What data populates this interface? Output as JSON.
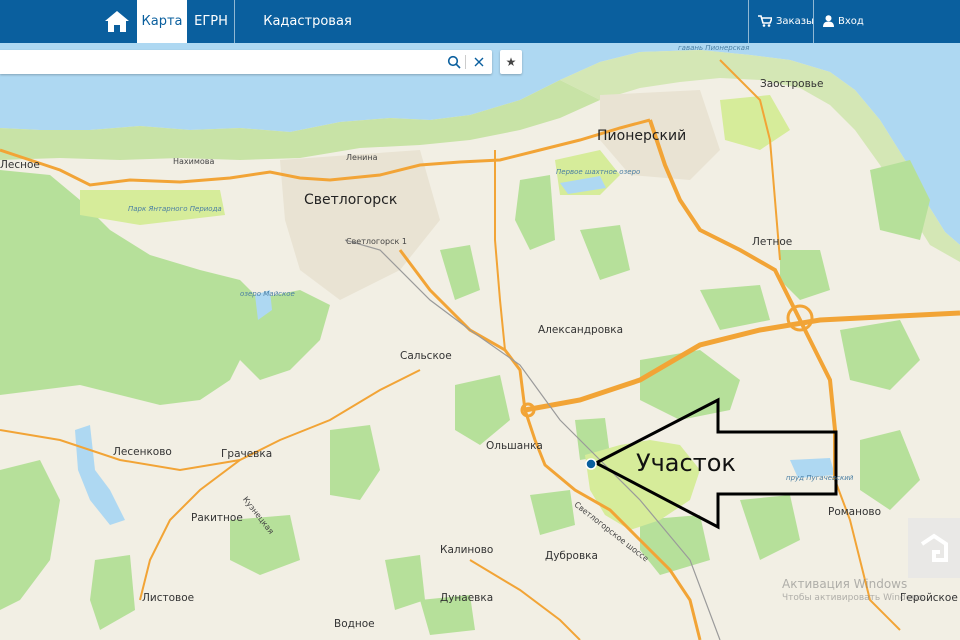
{
  "nav": {
    "tabs": [
      {
        "label": "Карта",
        "active": true
      },
      {
        "label": "ЕГРН",
        "active": false
      },
      {
        "label": "Кадастровая стоимость",
        "active": false
      }
    ],
    "orders_label": "Заказы",
    "login_label": "Вход"
  },
  "search": {
    "value": "",
    "placeholder": ""
  },
  "colors": {
    "header": "#0a5f9e",
    "water": "#aed8f2",
    "land": "#f2efe4",
    "forest": "#b6e09a",
    "road": "#f2a436",
    "marker": "#0a5f9e"
  },
  "icons": [
    "home-icon",
    "search-icon",
    "clear-icon",
    "star-icon",
    "cart-icon",
    "user-icon",
    "arrow-annotation"
  ],
  "map": {
    "places": {
      "pionersky": "Пионерский",
      "svetlogorsk": "Светлогорск",
      "zaostrovye": "Заостровье",
      "letnoe": "Летное",
      "lesnoe": "Лесное",
      "aleksandrovka": "Александровка",
      "salskoe": "Сальское",
      "olshanka": "Ольшанка",
      "lesenkovo": "Лесенково",
      "grachevka": "Грачевка",
      "rakitnoe": "Ракитное",
      "kalinovo": "Калиново",
      "dubrovka": "Дубровка",
      "listovoe": "Листовое",
      "dunaevka": "Дунаевка",
      "vodnoe": "Водное",
      "romanovo": "Романово",
      "geroyskoe": "Геройское",
      "svetlogorsk1": "Светлогорск 1",
      "nakhimova": "Нахимова",
      "lenina": "Ленина",
      "park": "Парк Янтарного Периода",
      "lake_mayskoe": "озеро Майское",
      "lake_pervoe": "Первое шахтное озеро",
      "harbor": "гавань Пионерская",
      "pond_pugachev": "пруд Пугачевский",
      "road_kuznetskaya": "Кузнецкая",
      "road_svetlogorsk": "Светлогорское шоссе"
    },
    "annotation": "Участок",
    "watermark_line1": "Активация Windows",
    "watermark_line2": "Чтобы активировать Windows"
  }
}
